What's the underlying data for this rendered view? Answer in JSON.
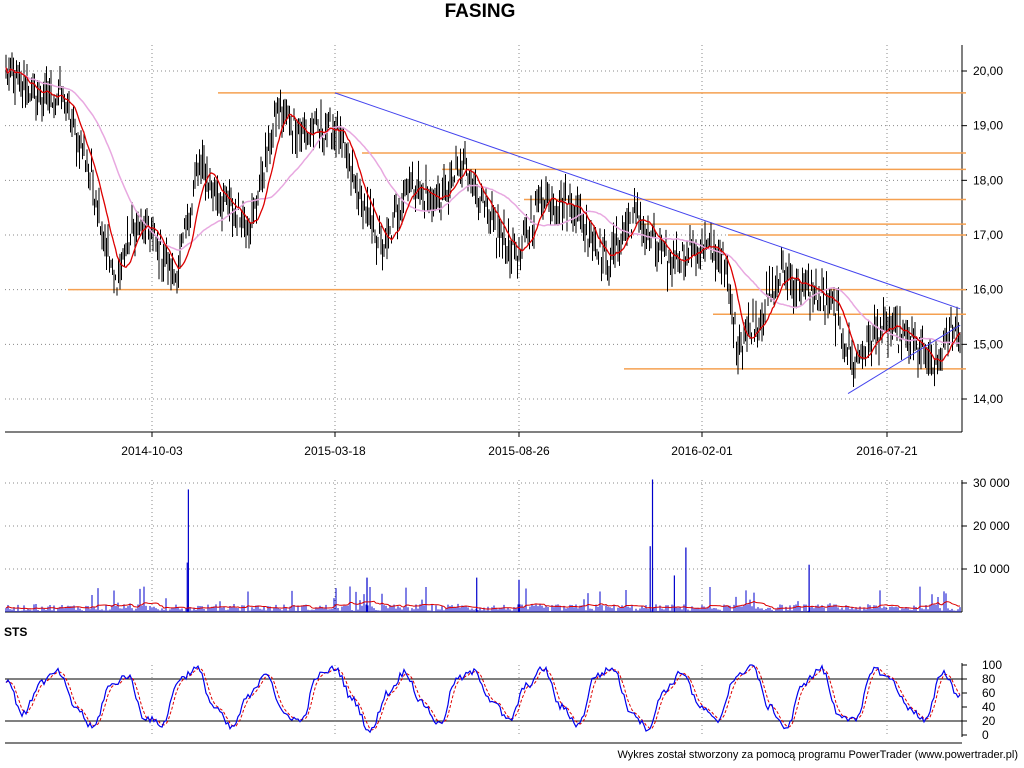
{
  "title": "FASING",
  "footer": "Wykres został stworzony za pomocą programu PowerTrader (www.powertrader.pl)",
  "colors": {
    "candles": "#000000",
    "ma_short": "#dd0000",
    "ma_long": "#e8a8e0",
    "trendline": "#4444ee",
    "levels": "#f5a050",
    "volume": "#0000cc",
    "volume_ma": "#dd0000",
    "sts_k": "#0000ee",
    "sts_d": "#dd0000",
    "grid": "#888888"
  },
  "chart_data": [
    {
      "type": "candlestick",
      "title": "FASING",
      "x_ticks": [
        "2014-10-03",
        "2015-03-18",
        "2015-08-26",
        "2016-02-01",
        "2016-07-21"
      ],
      "y_ticks": [
        "14,00",
        "15,00",
        "16,00",
        "17,00",
        "18,00",
        "19,00",
        "20,00"
      ],
      "ylim": [
        13.5,
        20.7
      ],
      "grid": true,
      "horizontal_levels": [
        19.6,
        18.5,
        18.2,
        17.65,
        17.2,
        17.0,
        16.0,
        15.55,
        14.55
      ],
      "trendlines": [
        {
          "from": [
            "2015-03-18",
            19.6
          ],
          "to": [
            "2016-10-10",
            15.65
          ]
        },
        {
          "from": [
            "2016-06-15",
            14.1
          ],
          "to": [
            "2016-10-10",
            15.35
          ]
        }
      ],
      "close_series": [
        {
          "date": "2014-05-01",
          "close": 20.0
        },
        {
          "date": "2014-06-01",
          "close": 19.6
        },
        {
          "date": "2014-07-01",
          "close": 19.5
        },
        {
          "date": "2014-08-01",
          "close": 18.0
        },
        {
          "date": "2014-08-25",
          "close": 16.1
        },
        {
          "date": "2014-09-15",
          "close": 17.2
        },
        {
          "date": "2014-10-03",
          "close": 17.0
        },
        {
          "date": "2014-10-25",
          "close": 16.2
        },
        {
          "date": "2014-11-15",
          "close": 18.3
        },
        {
          "date": "2014-12-10",
          "close": 17.5
        },
        {
          "date": "2015-01-01",
          "close": 17.2
        },
        {
          "date": "2015-01-25",
          "close": 19.3
        },
        {
          "date": "2015-02-20",
          "close": 18.8
        },
        {
          "date": "2015-03-18",
          "close": 19.0
        },
        {
          "date": "2015-04-10",
          "close": 17.6
        },
        {
          "date": "2015-05-01",
          "close": 16.7
        },
        {
          "date": "2015-05-20",
          "close": 18.0
        },
        {
          "date": "2015-06-15",
          "close": 17.6
        },
        {
          "date": "2015-07-10",
          "close": 18.3
        },
        {
          "date": "2015-08-01",
          "close": 17.2
        },
        {
          "date": "2015-08-26",
          "close": 16.6
        },
        {
          "date": "2015-09-15",
          "close": 17.8
        },
        {
          "date": "2015-10-15",
          "close": 17.5
        },
        {
          "date": "2015-11-10",
          "close": 16.5
        },
        {
          "date": "2015-12-05",
          "close": 17.4
        },
        {
          "date": "2016-01-01",
          "close": 16.5
        },
        {
          "date": "2016-02-01",
          "close": 16.8
        },
        {
          "date": "2016-02-20",
          "close": 16.6
        },
        {
          "date": "2016-03-05",
          "close": 15.0
        },
        {
          "date": "2016-03-25",
          "close": 15.5
        },
        {
          "date": "2016-04-15",
          "close": 16.3
        },
        {
          "date": "2016-05-10",
          "close": 16.0
        },
        {
          "date": "2016-06-01",
          "close": 15.7
        },
        {
          "date": "2016-06-20",
          "close": 14.6
        },
        {
          "date": "2016-07-10",
          "close": 15.2
        },
        {
          "date": "2016-07-21",
          "close": 15.3
        },
        {
          "date": "2016-08-20",
          "close": 15.0
        },
        {
          "date": "2016-09-10",
          "close": 14.5
        },
        {
          "date": "2016-10-01",
          "close": 15.3
        }
      ]
    },
    {
      "type": "bar",
      "title": "",
      "y_ticks": [
        "10 000",
        "20 000",
        "30 000"
      ],
      "ylim": [
        0,
        31000
      ],
      "grid": true,
      "spikes": [
        {
          "date": "2014-11-05",
          "value": 28500
        },
        {
          "date": "2014-11-04",
          "value": 11500
        },
        {
          "date": "2015-12-20",
          "value": 30800
        },
        {
          "date": "2015-12-18",
          "value": 15300
        },
        {
          "date": "2016-01-18",
          "value": 15000
        },
        {
          "date": "2016-01-08",
          "value": 8500
        },
        {
          "date": "2016-05-10",
          "value": 11000
        },
        {
          "date": "2015-04-15",
          "value": 8000
        },
        {
          "date": "2015-07-20",
          "value": 8000
        },
        {
          "date": "2015-08-26",
          "value": 7500
        }
      ]
    },
    {
      "type": "line",
      "title": "STS",
      "y_ticks": [
        "0",
        "20",
        "40",
        "60",
        "80",
        "100"
      ],
      "ylim": [
        0,
        100
      ],
      "overbought": 80,
      "oversold": 20,
      "series_k": [
        80,
        30,
        75,
        90,
        40,
        10,
        70,
        85,
        25,
        15,
        80,
        95,
        40,
        10,
        55,
        90,
        30,
        20,
        85,
        95,
        50,
        5,
        60,
        90,
        45,
        15,
        80,
        90,
        50,
        20,
        70,
        95,
        40,
        15,
        85,
        95,
        35,
        10,
        65,
        90,
        40,
        20,
        80,
        100,
        40,
        10,
        75,
        95,
        30,
        20,
        95,
        80,
        40,
        20,
        90,
        55
      ]
    }
  ]
}
